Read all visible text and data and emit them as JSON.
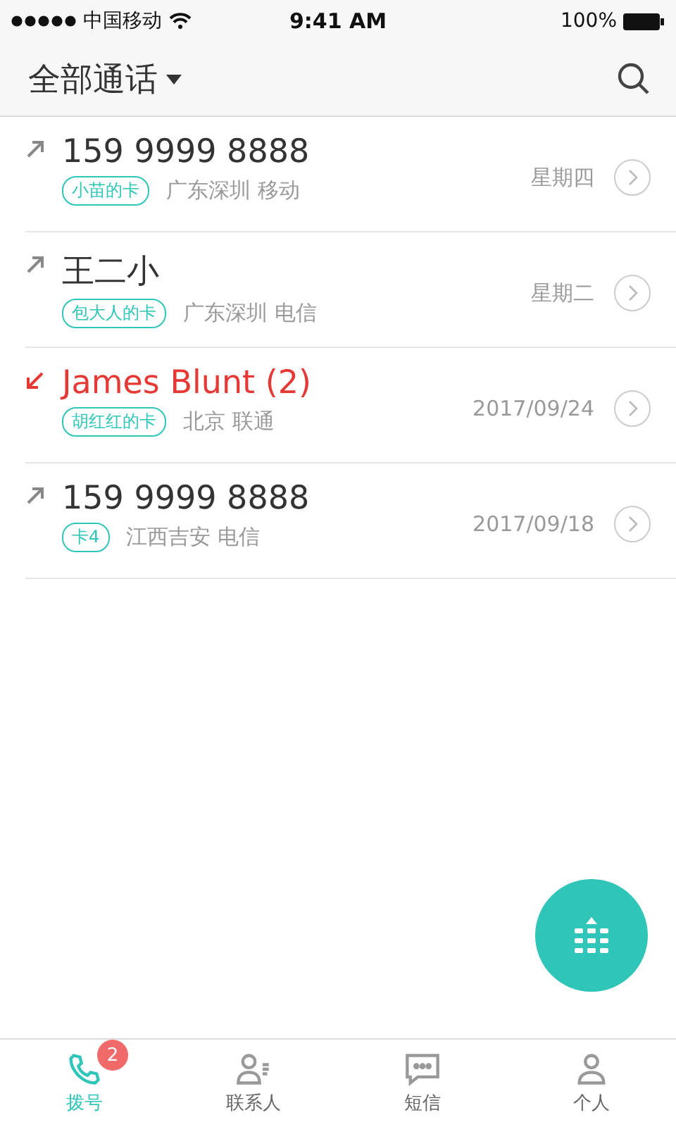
{
  "status_bar": {
    "carrier": "中国移动",
    "time": "9:41 AM",
    "battery": "100%"
  },
  "header": {
    "title": "全部通话"
  },
  "calls": [
    {
      "kind": "outgoing",
      "name": "159 9999 8888",
      "missed": false,
      "card": "小苗的卡",
      "location": "广东深圳 移动",
      "date": "星期四"
    },
    {
      "kind": "outgoing",
      "name": "王二小",
      "missed": false,
      "card": "包大人的卡",
      "location": "广东深圳 电信",
      "date": "星期二"
    },
    {
      "kind": "incoming",
      "name": "James Blunt (2)",
      "missed": true,
      "card": "胡红红的卡",
      "location": "北京 联通",
      "date": "2017/09/24"
    },
    {
      "kind": "outgoing",
      "name": "159 9999 8888",
      "missed": false,
      "card": "卡4",
      "location": "江西吉安 电信",
      "date": "2017/09/18"
    }
  ],
  "tab_bar": [
    {
      "kind": "phone",
      "label": "拨号",
      "selected": true,
      "badge": "2"
    },
    {
      "kind": "contacts",
      "label": "联系人",
      "selected": false
    },
    {
      "kind": "messages",
      "label": "短信",
      "selected": false
    },
    {
      "kind": "person",
      "label": "个人",
      "selected": false
    }
  ]
}
